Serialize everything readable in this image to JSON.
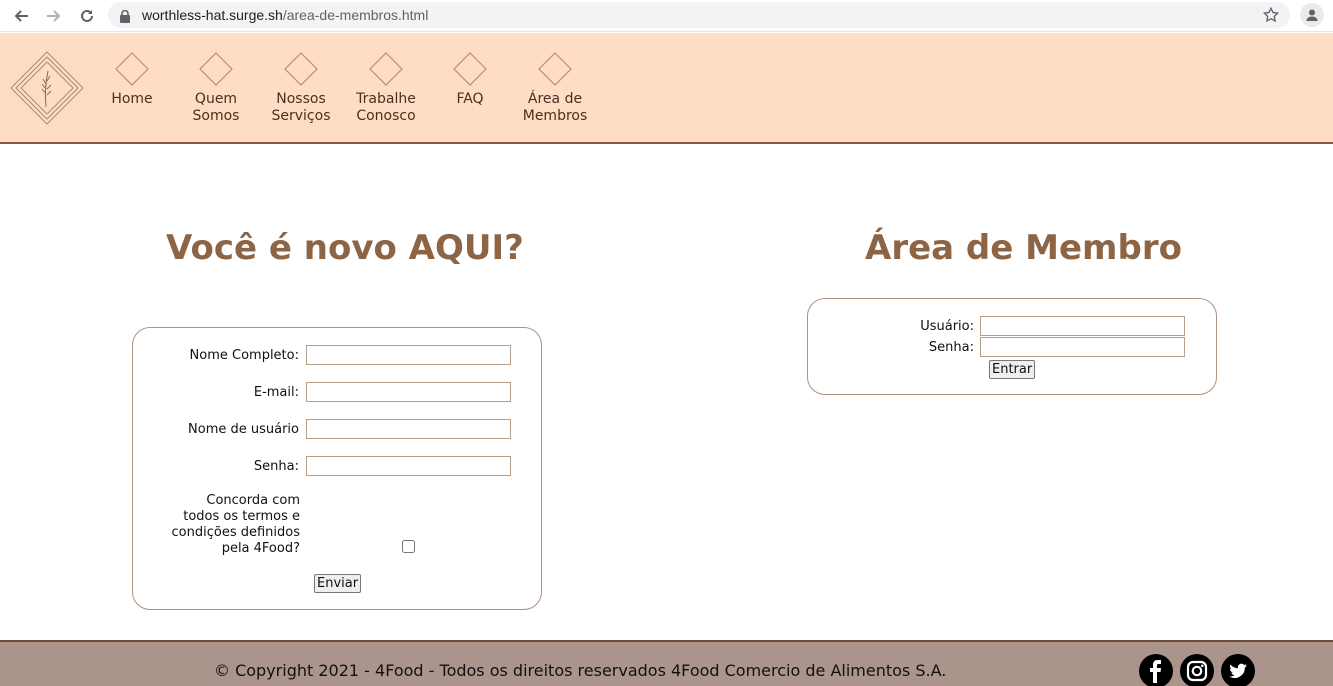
{
  "browser": {
    "url_host": "worthless-hat.surge.sh",
    "url_path": "/area-de-membros.html"
  },
  "nav": {
    "items": [
      {
        "label": "Home"
      },
      {
        "label": "Quem\nSomos"
      },
      {
        "label": "Nossos\nServiços"
      },
      {
        "label": "Trabalhe\nConosco"
      },
      {
        "label": "FAQ"
      },
      {
        "label": "Área de\nMembros"
      }
    ]
  },
  "register": {
    "title": "Você é novo AQUI?",
    "full_name_label": "Nome Completo:",
    "email_label": "E-mail:",
    "username_label": "Nome de usuário",
    "password_label": "Senha:",
    "terms_label": "Concorda com\ntodos os termos e\ncondições definidos\npela 4Food?",
    "submit_label": "Enviar"
  },
  "login": {
    "title": "Área de Membro",
    "user_label": "Usuário:",
    "password_label": "Senha:",
    "submit_label": "Entrar"
  },
  "footer": {
    "copyright": "© Copyright 2021 - 4Food - Todos os direitos reservados 4Food Comercio de Alimentos S.A.",
    "social": [
      "facebook-icon",
      "instagram-icon",
      "twitter-icon"
    ]
  },
  "colors": {
    "header_bg": "#ffdcc4",
    "title_brown": "#8d6444",
    "footer_bg": "#ab948b"
  }
}
